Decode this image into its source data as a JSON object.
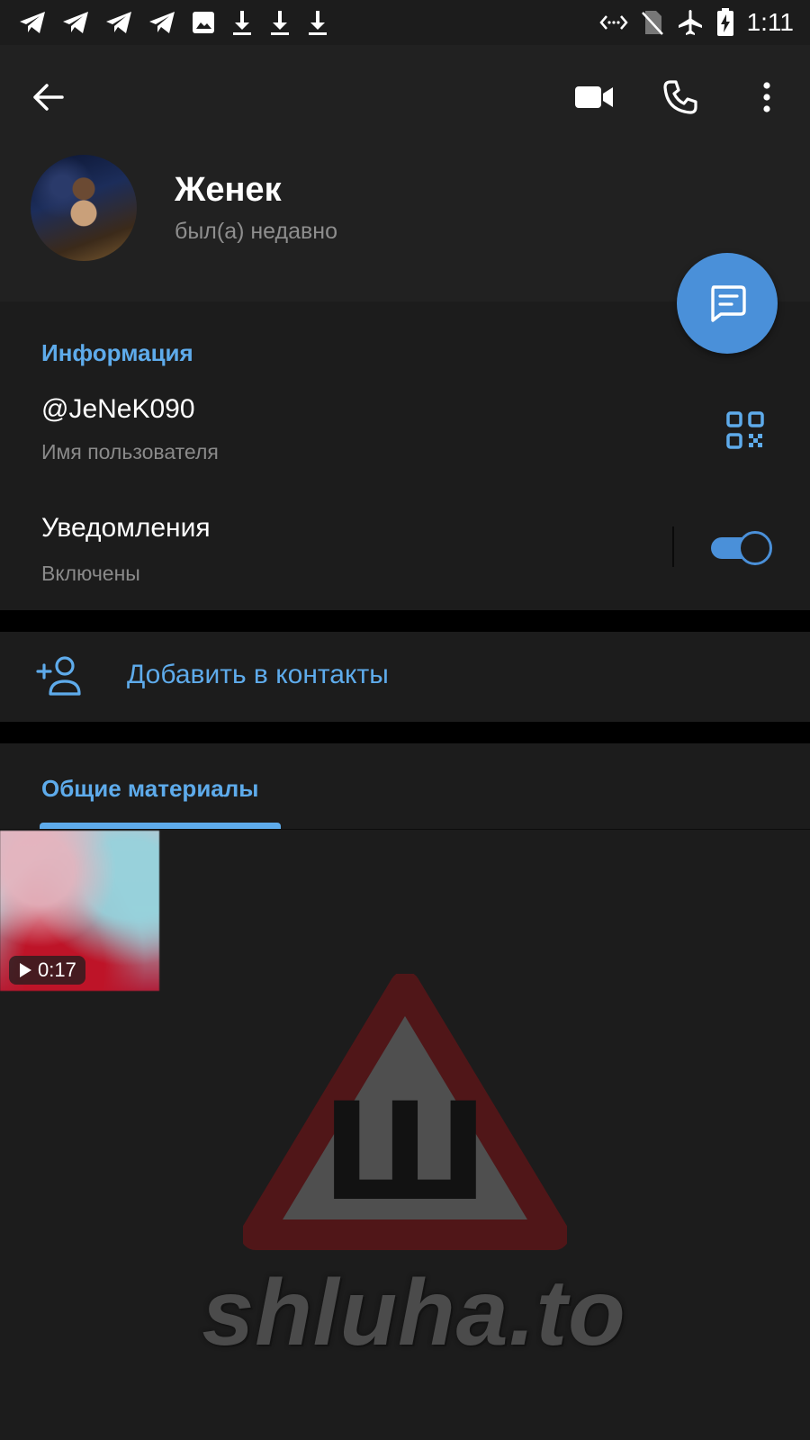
{
  "status_bar": {
    "time": "1:11",
    "left_icons": [
      "telegram-icon",
      "telegram-icon",
      "telegram-icon",
      "telegram-icon",
      "image-icon",
      "download-icon",
      "download-icon",
      "download-icon"
    ],
    "right_icons": [
      "data-sync-icon",
      "no-sim-icon",
      "airplane-icon",
      "battery-charging-icon"
    ]
  },
  "header": {
    "name": "Женек",
    "status": "был(а) недавно"
  },
  "info": {
    "section_title": "Информация",
    "username": "@JeNeK090",
    "username_label": "Имя пользователя",
    "notifications_label": "Уведомления",
    "notifications_state": "Включены",
    "notifications_on": true
  },
  "actions": {
    "add_contact": "Добавить в контакты"
  },
  "media": {
    "tab_title": "Общие материалы",
    "items": [
      {
        "type": "video",
        "duration": "0:17"
      }
    ]
  },
  "watermark": {
    "glyph": "Ш",
    "text": "shluha.to"
  },
  "colors": {
    "accent": "#5eabeb",
    "fab": "#4a90d9",
    "background": "#1c1c1c",
    "header": "#212121"
  }
}
